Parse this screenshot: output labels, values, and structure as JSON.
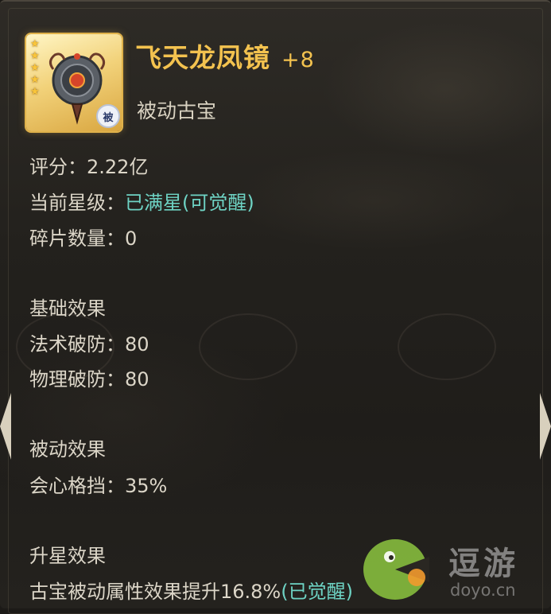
{
  "item": {
    "name": "飞天龙凤镜",
    "enhance": "+8",
    "type": "被动古宝",
    "badge": "被",
    "stars": [
      "★",
      "★",
      "★",
      "★",
      "★"
    ],
    "icon": "bronze-mirror-treasure-icon"
  },
  "stats": {
    "score_label": "评分：",
    "score_value": "2.22亿",
    "star_label": "当前星级：",
    "star_value": "已满星(可觉醒)",
    "shard_label": "碎片数量：",
    "shard_value": "0"
  },
  "basic_effects": {
    "heading": "基础效果",
    "lines": [
      "法术破防：80",
      "物理破防：80"
    ]
  },
  "passive_effects": {
    "heading": "被动效果",
    "lines": [
      "会心格挡：35%"
    ]
  },
  "star_effects": {
    "heading": "升星效果",
    "text": "古宝被动属性效果提升16.8%",
    "status": "(已觉醒)"
  },
  "watermark": {
    "text": "逗游",
    "url": "doyo.cn"
  },
  "colors": {
    "title": "#f3c24f",
    "highlight": "#6ed3c4",
    "body_text": "#dcd6c8",
    "background": "#23211d"
  }
}
